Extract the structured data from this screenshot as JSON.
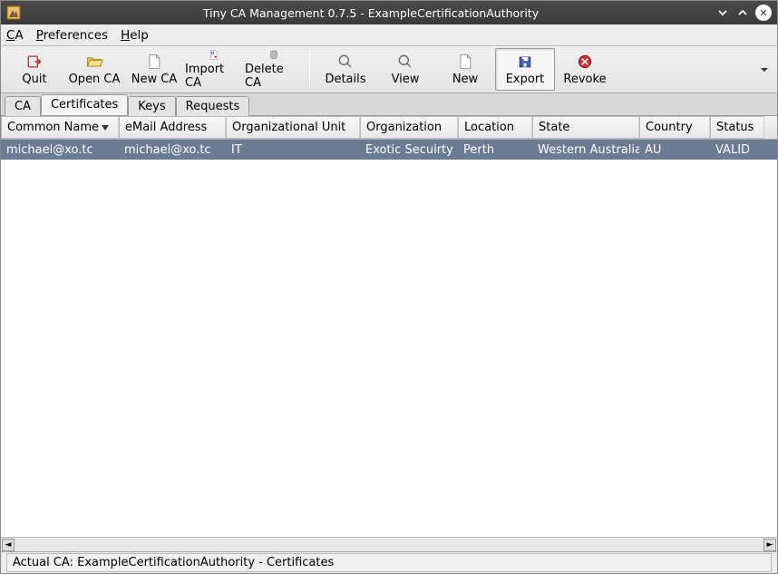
{
  "window": {
    "title": "Tiny CA Management 0.7.5 - ExampleCertificationAuthority"
  },
  "menu": {
    "ca": "CA",
    "preferences": "Preferences",
    "help": "Help"
  },
  "toolbar": {
    "quit": "Quit",
    "open_ca": "Open CA",
    "new_ca": "New CA",
    "import_ca": "Import CA",
    "delete_ca": "Delete CA",
    "details": "Details",
    "view": "View",
    "new": "New",
    "export": "Export",
    "revoke": "Revoke"
  },
  "tabs": {
    "ca": "CA",
    "certificates": "Certificates",
    "keys": "Keys",
    "requests": "Requests",
    "active": "certificates"
  },
  "columns": {
    "common_name": "Common Name",
    "email": "eMail Address",
    "ou": "Organizational Unit",
    "org": "Organization",
    "location": "Location",
    "state": "State",
    "country": "Country",
    "status": "Status"
  },
  "rows": [
    {
      "common_name": "michael@xo.tc",
      "email": "michael@xo.tc",
      "ou": "IT",
      "org": "Exotic Secuirty",
      "location": "Perth",
      "state": "Western Australia",
      "country": "AU",
      "status": "VALID"
    }
  ],
  "status": "Actual CA: ExampleCertificationAuthority - Certificates"
}
